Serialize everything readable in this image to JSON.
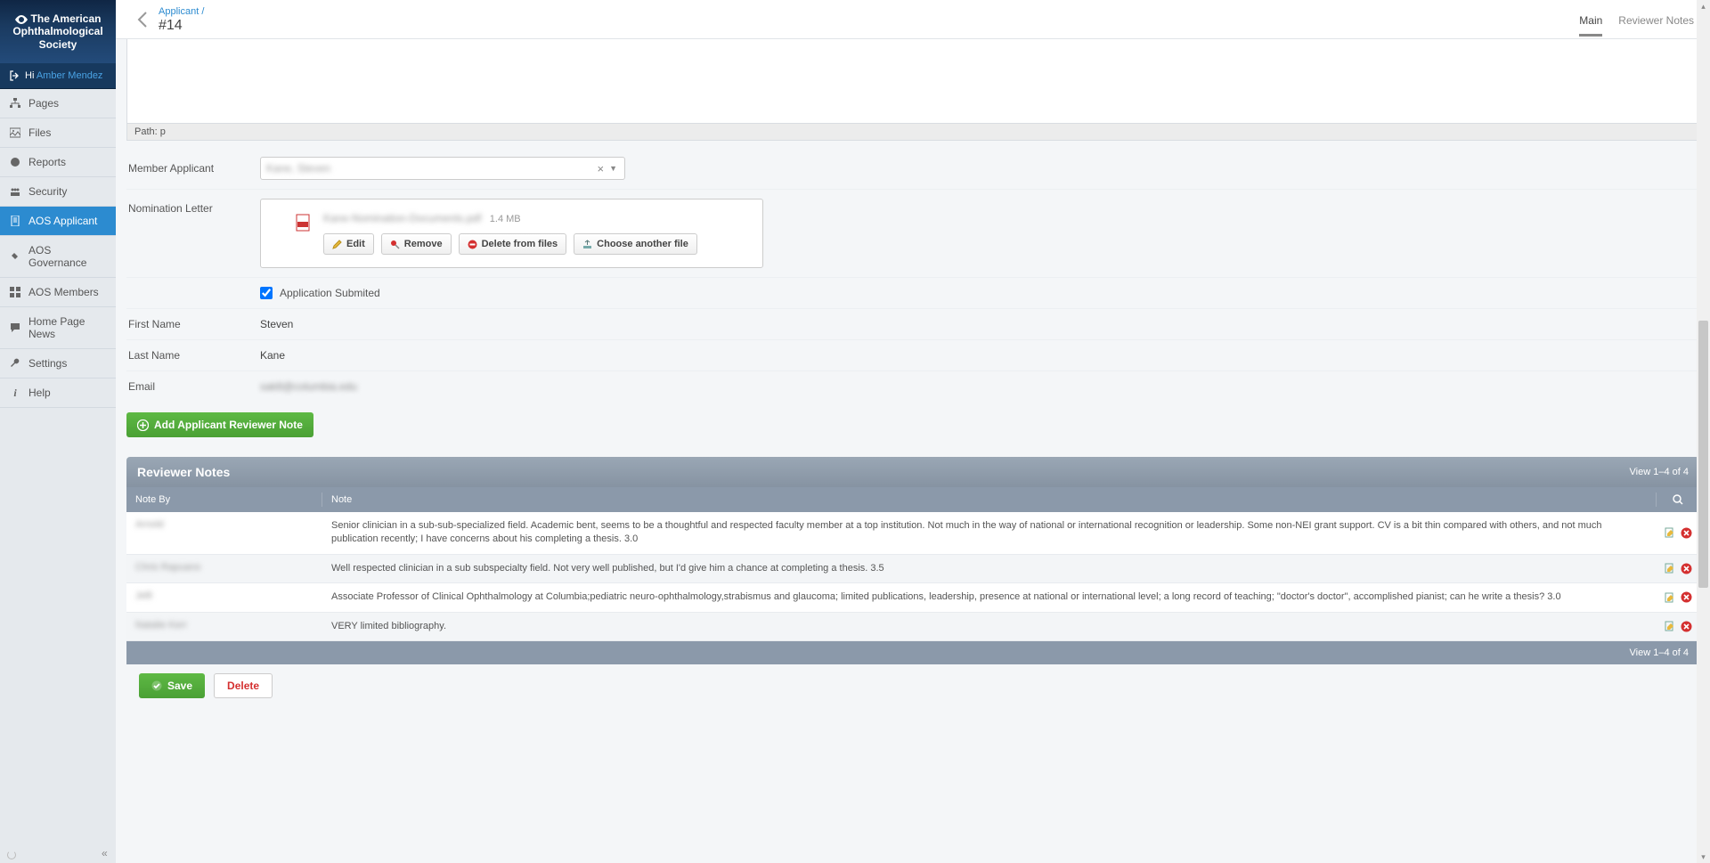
{
  "brand": "The American Ophthalmological Society",
  "greeting": {
    "prefix": "Hi",
    "user": "Amber Mendez"
  },
  "nav": [
    {
      "label": "Pages",
      "icon": "sitemap-icon"
    },
    {
      "label": "Files",
      "icon": "image-icon"
    },
    {
      "label": "Reports",
      "icon": "globe-icon"
    },
    {
      "label": "Security",
      "icon": "people-icon"
    },
    {
      "label": "AOS Applicant",
      "icon": "form-icon",
      "active": true
    },
    {
      "label": "AOS Governance",
      "icon": "gavel-icon"
    },
    {
      "label": "AOS Members",
      "icon": "grid-icon"
    },
    {
      "label": "Home Page News",
      "icon": "chat-icon"
    },
    {
      "label": "Settings",
      "icon": "wrench-icon"
    },
    {
      "label": "Help",
      "icon": "info-icon"
    }
  ],
  "breadcrumb": {
    "parent": "Applicant",
    "current": "#14"
  },
  "tabs": [
    {
      "label": "Main",
      "active": true
    },
    {
      "label": "Reviewer Notes"
    }
  ],
  "pathbar": "Path: p",
  "fields": {
    "member_applicant": {
      "label": "Member Applicant",
      "value": "Kane, Steven"
    },
    "nomination_letter": {
      "label": "Nomination Letter",
      "file_name": "Kane-Nomination-Documents.pdf",
      "file_size": "1.4 MB",
      "buttons": {
        "edit": "Edit",
        "remove": "Remove",
        "delete_files": "Delete from files",
        "choose_another": "Choose another file"
      }
    },
    "application_submitted": {
      "label": "Application Submited",
      "checked": true
    },
    "first_name": {
      "label": "First Name",
      "value": "Steven"
    },
    "last_name": {
      "label": "Last Name",
      "value": "Kane"
    },
    "email": {
      "label": "Email",
      "value": "sak8@columbia.edu"
    }
  },
  "add_note_button": "Add Applicant Reviewer Note",
  "reviewer_notes": {
    "title": "Reviewer Notes",
    "count_text": "View 1–4 of 4",
    "columns": {
      "by": "Note By",
      "note": "Note"
    },
    "rows": [
      {
        "by": "Arnold",
        "note": "Senior clinician in a sub-sub-specialized field. Academic bent, seems to be a thoughtful and respected faculty member at a top institution. Not much in the way of national or international recognition or leadership. Some non-NEI grant support. CV is a bit thin compared with others, and not much publication recently; I have concerns about his completing a thesis. 3.0"
      },
      {
        "by": "Chris Rapuano",
        "note": "Well respected clinician in a sub subspecialty field. Not very well published, but I'd give him a chance at completing a thesis. 3.5"
      },
      {
        "by": "Jelli",
        "note": "Associate Professor of Clinical Ophthalmology at Columbia;pediatric neuro-ophthalmology,strabismus and glaucoma; limited publications, leadership, presence at national or international level; a long record of teaching; \"doctor's doctor\", accomplished pianist; can he write a thesis? 3.0"
      },
      {
        "by": "Natalie Kerr",
        "note": "VERY limited bibliography."
      }
    ]
  },
  "footer": {
    "save": "Save",
    "delete": "Delete"
  }
}
